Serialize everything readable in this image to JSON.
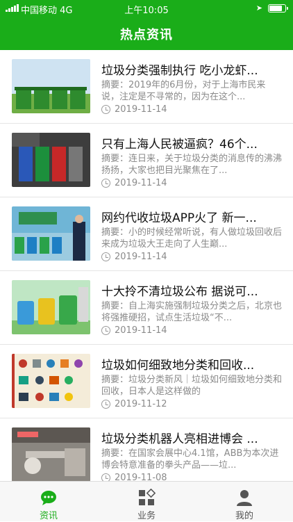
{
  "status_bar": {
    "carrier": "中国移动 4G",
    "time": "上午10:05",
    "battery_level": 0.85
  },
  "header": {
    "title": "热点资讯"
  },
  "articles": [
    {
      "title": "垃圾分类强制执行 吃小龙虾...",
      "abstract": "摘要：2019年的6月份，对于上海市民来说，注定是不寻常的，因为在这个...",
      "date": "2019-11-14",
      "thumb_icon": "green-bins-photo"
    },
    {
      "title": "只有上海人民被逼疯？46个...",
      "abstract": "摘要：连日来，关于垃圾分类的消息传的沸沸扬扬，大家也把目光聚焦在了...",
      "date": "2019-11-14",
      "thumb_icon": "sorting-bins-photo"
    },
    {
      "title": "网约代收垃圾APP火了 新一...",
      "abstract": "摘要：小的时候经常听说，有人做垃圾回收后来成为垃圾大王走向了人生巅...",
      "date": "2019-11-14",
      "thumb_icon": "news-anchor-photo"
    },
    {
      "title": "十大拎不清垃圾公布 据说可...",
      "abstract": "摘要：自上海实施强制垃圾分类之后，北京也将强推硬招，试点生活垃圾“不...",
      "date": "2019-11-14",
      "thumb_icon": "cartoon-bins-illustration"
    },
    {
      "title": "垃圾如何细致地分类和回收...",
      "abstract": "摘要：垃圾分类新风｜垃圾如何细致地分类和回收，日本人是这样做的",
      "date": "2019-11-12",
      "thumb_icon": "recycling-chart-illustration"
    },
    {
      "title": "垃圾分类机器人亮相进博会 ...",
      "abstract": "摘要：在国家会展中心4.1馆，ABB为本次进博会特意准备的拳头产品——垃...",
      "date": "2019-11-08",
      "thumb_icon": "robot-exhibition-photo"
    }
  ],
  "tabs": [
    {
      "label": "资讯",
      "icon": "chat-bubble-icon",
      "active": true
    },
    {
      "label": "业务",
      "icon": "grid-apps-icon",
      "active": false
    },
    {
      "label": "我的",
      "icon": "person-icon",
      "active": false
    }
  ],
  "colors": {
    "brand": "#1aad19",
    "text": "#111111",
    "muted": "#8a8a8a"
  }
}
